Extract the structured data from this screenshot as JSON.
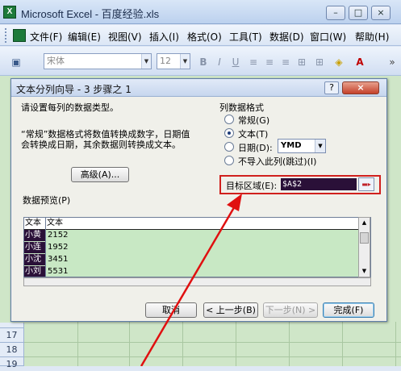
{
  "window": {
    "app_icon": "excel-icon",
    "title": "Microsoft Excel - 百度经验.xls"
  },
  "menu": [
    "文件(F)",
    "编辑(E)",
    "视图(V)",
    "插入(I)",
    "格式(O)",
    "工具(T)",
    "数据(D)",
    "窗口(W)",
    "帮助(H)"
  ],
  "toolbar": {
    "font_name": "宋体",
    "font_size": "12"
  },
  "rows": [
    "17",
    "18",
    "19"
  ],
  "dialog": {
    "title": "文本分列向导 - 3 步骤之 1",
    "help": "?",
    "close": "×",
    "instruction": "请设置每列的数据类型。",
    "description_line1": "“常规”数据格式将数值转换成数字，日期值",
    "description_line2": "会转换成日期，其余数据则转换成文本。",
    "advanced_button": "高级(A)...",
    "column_format_label": "列数据格式",
    "formats": [
      {
        "label": "常规(G)",
        "selected": false
      },
      {
        "label": "文本(T)",
        "selected": true
      },
      {
        "label": "日期(D):",
        "selected": false
      },
      {
        "label": "不导入此列(跳过)(I)",
        "selected": false
      }
    ],
    "date_format": "YMD",
    "destination_label": "目标区域(E):",
    "destination_value": "$A$2",
    "preview_label": "数据预览(P)",
    "preview_headers": [
      "文本",
      "文本"
    ],
    "preview_rows": [
      [
        "小黄",
        "2152"
      ],
      [
        "小连",
        "1952"
      ],
      [
        "小沈",
        "3451"
      ],
      [
        "小刘",
        "5531"
      ]
    ],
    "buttons": {
      "cancel": "取消",
      "back": "< 上一步(B)",
      "next": "下一步(N) >",
      "finish": "完成(F)"
    }
  },
  "colors": {
    "highlight_box": "#d0201d",
    "sheet_fill": "#cfe6c8"
  }
}
